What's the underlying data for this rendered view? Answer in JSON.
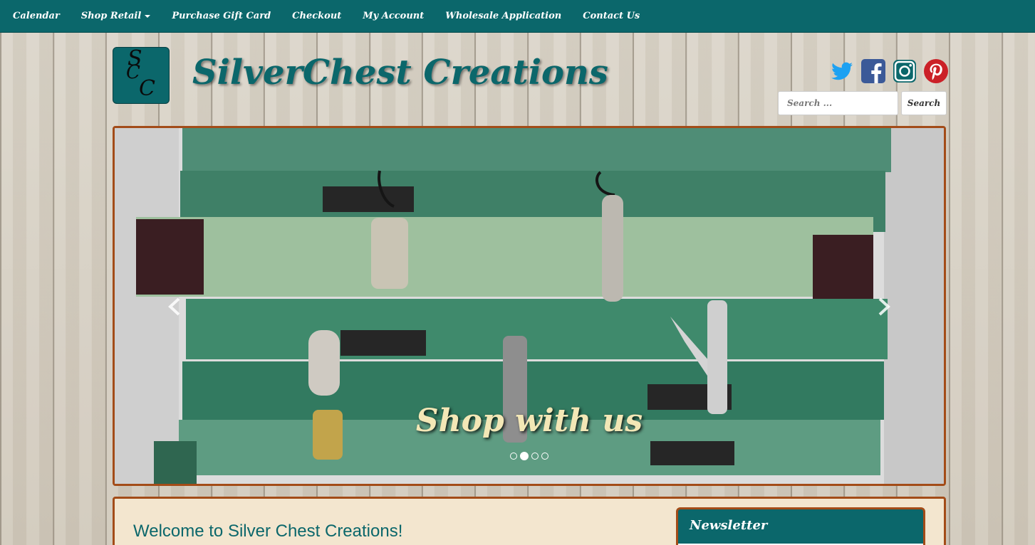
{
  "nav": {
    "items": [
      {
        "label": "Calendar",
        "has_dropdown": false
      },
      {
        "label": "Shop Retail",
        "has_dropdown": true
      },
      {
        "label": "Purchase Gift Card",
        "has_dropdown": false
      },
      {
        "label": "Checkout",
        "has_dropdown": false
      },
      {
        "label": "My Account",
        "has_dropdown": false
      },
      {
        "label": "Wholesale Application",
        "has_dropdown": false
      },
      {
        "label": "Contact Us",
        "has_dropdown": false
      }
    ],
    "background_color": "#0b676b"
  },
  "header": {
    "logo": {
      "letters": [
        "S",
        "C",
        "C"
      ],
      "background_color": "#0b676b"
    },
    "site_title": "SilverChest Creations",
    "social": [
      {
        "name": "twitter-icon",
        "color": "#1da1f2"
      },
      {
        "name": "facebook-icon",
        "color": "#3b5998"
      },
      {
        "name": "instagram-icon",
        "color": "#0b676b"
      },
      {
        "name": "pinterest-icon",
        "color": "#cb2027"
      }
    ],
    "search": {
      "placeholder": "Search ...",
      "button_label": "Search"
    }
  },
  "carousel": {
    "caption": "Shop with us",
    "slide_count": 4,
    "active_slide": 2,
    "border_color": "#a34c18"
  },
  "content": {
    "welcome_heading": "Welcome to Silver Chest Creations!",
    "newsletter_title": "Newsletter"
  }
}
